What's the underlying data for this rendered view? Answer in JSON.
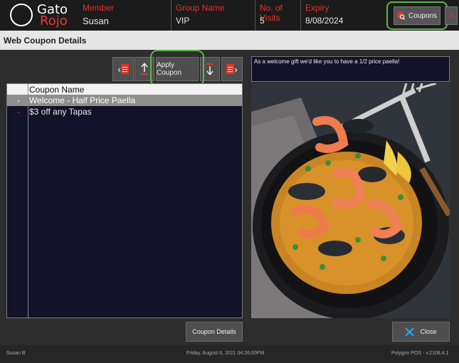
{
  "logo": {
    "line1": "Gato",
    "line2": "Rojo"
  },
  "member": {
    "label": "Member",
    "value": "Susan"
  },
  "group": {
    "label": "Group Name",
    "value": "VIP"
  },
  "visits": {
    "label": "No. of Visits",
    "value": "5"
  },
  "expiry": {
    "label": "Expiry",
    "value": "8/08/2024"
  },
  "header_buttons": {
    "coupons": "Coupons",
    "close_x": "X"
  },
  "window": {
    "title": "Web Coupon Details"
  },
  "toolbar": {
    "apply": "Apply Coupon"
  },
  "grid": {
    "column_header": "Coupon Name",
    "rows": [
      {
        "marker": "-",
        "name": "Welcome - Half Price Paella",
        "selected": true
      },
      {
        "marker": "-",
        "name": "$3 off any Tapas",
        "selected": false
      }
    ]
  },
  "description": "As a welcome gift we'd like you to have a 1/2 price paella!",
  "buttons": {
    "details": "Coupon Details",
    "close": "Close"
  },
  "footer": {
    "user": "Susan B",
    "datetime": "Friday, August  6, 2021     04:26:00PM",
    "version": "Polygon POS - v.2108.4.1"
  },
  "colors": {
    "accent_red": "#e0352b",
    "highlight_green": "#58b947"
  }
}
